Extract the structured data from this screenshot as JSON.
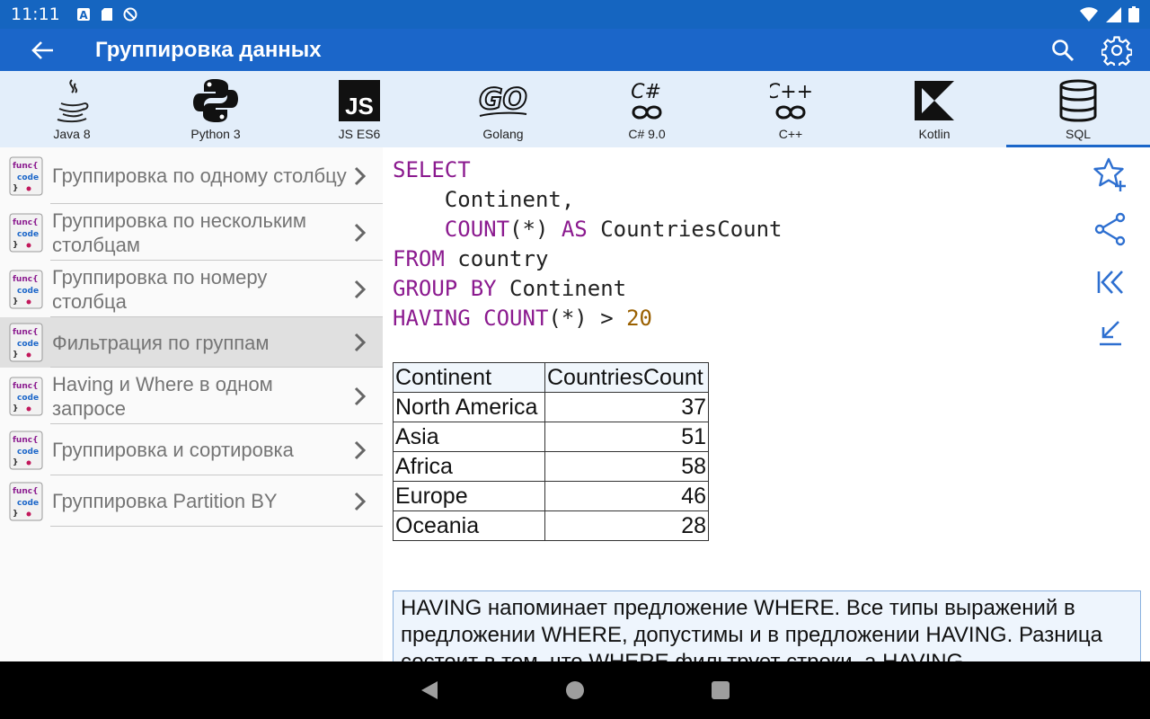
{
  "status_bar": {
    "time": "11:11"
  },
  "app_bar": {
    "title": "Группировка данных"
  },
  "languages": [
    {
      "label": "Java 8",
      "icon": "java-icon",
      "active": false
    },
    {
      "label": "Python 3",
      "icon": "python-icon",
      "active": false
    },
    {
      "label": "JS ES6",
      "icon": "js-icon",
      "active": false
    },
    {
      "label": "Golang",
      "icon": "go-icon",
      "active": false
    },
    {
      "label": "C# 9.0",
      "icon": "csharp-icon",
      "active": false
    },
    {
      "label": "C++",
      "icon": "cpp-icon",
      "active": false
    },
    {
      "label": "Kotlin",
      "icon": "kotlin-icon",
      "active": false
    },
    {
      "label": "SQL",
      "icon": "database-icon",
      "active": true
    }
  ],
  "sidebar": {
    "items": [
      {
        "label": "Группировка по одному столбцу",
        "active": false
      },
      {
        "label": "Группировка по нескольким столбцам",
        "active": false
      },
      {
        "label": "Группировка по номеру столбца",
        "active": false
      },
      {
        "label": "Фильтрация по группам",
        "active": true
      },
      {
        "label": "Having и Where в одном запросе",
        "active": false
      },
      {
        "label": "Группировка и сортировка",
        "active": false
      },
      {
        "label": "Группировка Partition BY",
        "active": false
      }
    ]
  },
  "code": {
    "l1_kw": "SELECT",
    "l2": "    Continent,",
    "l3_kw1": "COUNT",
    "l3_mid": "(*) ",
    "l3_kw2": "AS",
    "l3_rest": " CountriesCount",
    "l4_kw": "FROM",
    "l4_rest": " country",
    "l5_kw": "GROUP BY",
    "l5_rest": " Continent",
    "l6_kw1": "HAVING",
    "l6_kw2": "COUNT",
    "l6_mid": "(*) > ",
    "l6_num": "20"
  },
  "result": {
    "headers": [
      "Continent",
      "CountriesCount"
    ],
    "rows": [
      [
        "North America",
        "37"
      ],
      [
        "Asia",
        "51"
      ],
      [
        "Africa",
        "58"
      ],
      [
        "Europe",
        "46"
      ],
      [
        "Oceania",
        "28"
      ]
    ]
  },
  "note": {
    "text": "HAVING напоминает предложение WHERE. Все типы выражений в предложении WHERE, допустимы и в предложении HAVING. Разница состоит в том, что WHERE фильтрует строки, а HAVING"
  },
  "colors": {
    "primary": "#1b66c9",
    "status_bar": "#1565c0",
    "keyword": "#8b1a8f",
    "number": "#9a6000"
  }
}
